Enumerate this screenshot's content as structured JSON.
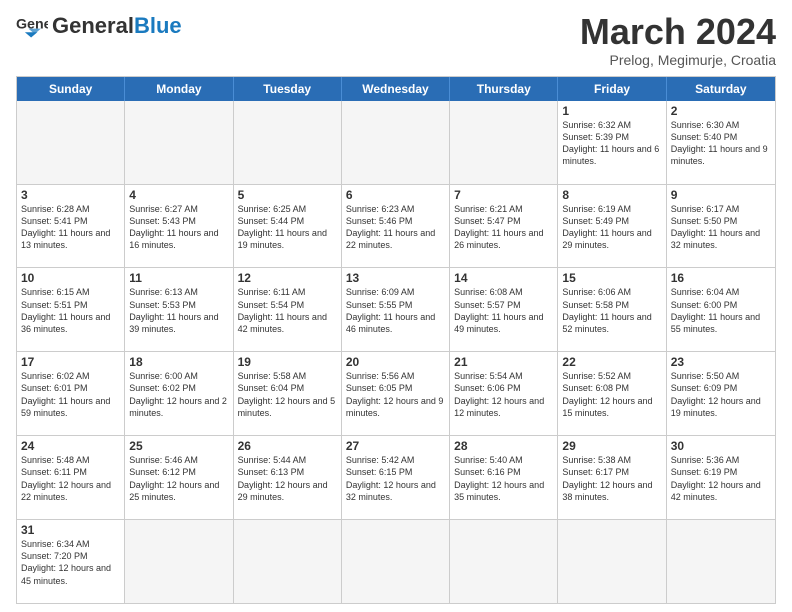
{
  "header": {
    "logo_general": "General",
    "logo_blue": "Blue",
    "month_title": "March 2024",
    "subtitle": "Prelog, Megimurje, Croatia"
  },
  "days_of_week": [
    "Sunday",
    "Monday",
    "Tuesday",
    "Wednesday",
    "Thursday",
    "Friday",
    "Saturday"
  ],
  "weeks": [
    [
      {
        "day": "",
        "info": ""
      },
      {
        "day": "",
        "info": ""
      },
      {
        "day": "",
        "info": ""
      },
      {
        "day": "",
        "info": ""
      },
      {
        "day": "",
        "info": ""
      },
      {
        "day": "1",
        "info": "Sunrise: 6:32 AM\nSunset: 5:39 PM\nDaylight: 11 hours and 6 minutes."
      },
      {
        "day": "2",
        "info": "Sunrise: 6:30 AM\nSunset: 5:40 PM\nDaylight: 11 hours and 9 minutes."
      }
    ],
    [
      {
        "day": "3",
        "info": "Sunrise: 6:28 AM\nSunset: 5:41 PM\nDaylight: 11 hours and 13 minutes."
      },
      {
        "day": "4",
        "info": "Sunrise: 6:27 AM\nSunset: 5:43 PM\nDaylight: 11 hours and 16 minutes."
      },
      {
        "day": "5",
        "info": "Sunrise: 6:25 AM\nSunset: 5:44 PM\nDaylight: 11 hours and 19 minutes."
      },
      {
        "day": "6",
        "info": "Sunrise: 6:23 AM\nSunset: 5:46 PM\nDaylight: 11 hours and 22 minutes."
      },
      {
        "day": "7",
        "info": "Sunrise: 6:21 AM\nSunset: 5:47 PM\nDaylight: 11 hours and 26 minutes."
      },
      {
        "day": "8",
        "info": "Sunrise: 6:19 AM\nSunset: 5:49 PM\nDaylight: 11 hours and 29 minutes."
      },
      {
        "day": "9",
        "info": "Sunrise: 6:17 AM\nSunset: 5:50 PM\nDaylight: 11 hours and 32 minutes."
      }
    ],
    [
      {
        "day": "10",
        "info": "Sunrise: 6:15 AM\nSunset: 5:51 PM\nDaylight: 11 hours and 36 minutes."
      },
      {
        "day": "11",
        "info": "Sunrise: 6:13 AM\nSunset: 5:53 PM\nDaylight: 11 hours and 39 minutes."
      },
      {
        "day": "12",
        "info": "Sunrise: 6:11 AM\nSunset: 5:54 PM\nDaylight: 11 hours and 42 minutes."
      },
      {
        "day": "13",
        "info": "Sunrise: 6:09 AM\nSunset: 5:55 PM\nDaylight: 11 hours and 46 minutes."
      },
      {
        "day": "14",
        "info": "Sunrise: 6:08 AM\nSunset: 5:57 PM\nDaylight: 11 hours and 49 minutes."
      },
      {
        "day": "15",
        "info": "Sunrise: 6:06 AM\nSunset: 5:58 PM\nDaylight: 11 hours and 52 minutes."
      },
      {
        "day": "16",
        "info": "Sunrise: 6:04 AM\nSunset: 6:00 PM\nDaylight: 11 hours and 55 minutes."
      }
    ],
    [
      {
        "day": "17",
        "info": "Sunrise: 6:02 AM\nSunset: 6:01 PM\nDaylight: 11 hours and 59 minutes."
      },
      {
        "day": "18",
        "info": "Sunrise: 6:00 AM\nSunset: 6:02 PM\nDaylight: 12 hours and 2 minutes."
      },
      {
        "day": "19",
        "info": "Sunrise: 5:58 AM\nSunset: 6:04 PM\nDaylight: 12 hours and 5 minutes."
      },
      {
        "day": "20",
        "info": "Sunrise: 5:56 AM\nSunset: 6:05 PM\nDaylight: 12 hours and 9 minutes."
      },
      {
        "day": "21",
        "info": "Sunrise: 5:54 AM\nSunset: 6:06 PM\nDaylight: 12 hours and 12 minutes."
      },
      {
        "day": "22",
        "info": "Sunrise: 5:52 AM\nSunset: 6:08 PM\nDaylight: 12 hours and 15 minutes."
      },
      {
        "day": "23",
        "info": "Sunrise: 5:50 AM\nSunset: 6:09 PM\nDaylight: 12 hours and 19 minutes."
      }
    ],
    [
      {
        "day": "24",
        "info": "Sunrise: 5:48 AM\nSunset: 6:11 PM\nDaylight: 12 hours and 22 minutes."
      },
      {
        "day": "25",
        "info": "Sunrise: 5:46 AM\nSunset: 6:12 PM\nDaylight: 12 hours and 25 minutes."
      },
      {
        "day": "26",
        "info": "Sunrise: 5:44 AM\nSunset: 6:13 PM\nDaylight: 12 hours and 29 minutes."
      },
      {
        "day": "27",
        "info": "Sunrise: 5:42 AM\nSunset: 6:15 PM\nDaylight: 12 hours and 32 minutes."
      },
      {
        "day": "28",
        "info": "Sunrise: 5:40 AM\nSunset: 6:16 PM\nDaylight: 12 hours and 35 minutes."
      },
      {
        "day": "29",
        "info": "Sunrise: 5:38 AM\nSunset: 6:17 PM\nDaylight: 12 hours and 38 minutes."
      },
      {
        "day": "30",
        "info": "Sunrise: 5:36 AM\nSunset: 6:19 PM\nDaylight: 12 hours and 42 minutes."
      }
    ],
    [
      {
        "day": "31",
        "info": "Sunrise: 6:34 AM\nSunset: 7:20 PM\nDaylight: 12 hours and 45 minutes."
      },
      {
        "day": "",
        "info": ""
      },
      {
        "day": "",
        "info": ""
      },
      {
        "day": "",
        "info": ""
      },
      {
        "day": "",
        "info": ""
      },
      {
        "day": "",
        "info": ""
      },
      {
        "day": "",
        "info": ""
      }
    ]
  ]
}
